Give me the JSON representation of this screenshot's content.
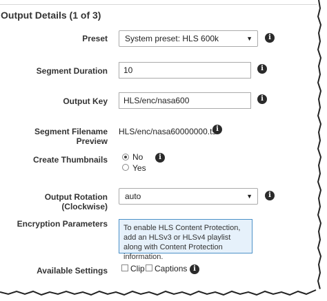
{
  "header": {
    "title": "Output Details (1 of 3)"
  },
  "fields": {
    "preset": {
      "label": "Preset",
      "value": "System preset: HLS 600k"
    },
    "segment_duration": {
      "label": "Segment Duration",
      "value": "10"
    },
    "output_key": {
      "label": "Output Key",
      "value": "HLS/enc/nasa600"
    },
    "segment_filename_preview": {
      "label": "Segment Filename Preview",
      "value": "HLS/enc/nasa60000000.ts"
    },
    "create_thumbnails": {
      "label": "Create Thumbnails",
      "options": [
        "No",
        "Yes"
      ],
      "selected": "No"
    },
    "output_rotation": {
      "label": "Output Rotation",
      "label_sub": "(Clockwise)",
      "value": "auto"
    },
    "encryption": {
      "label": "Encryption Parameters",
      "notice": "To enable HLS Content Protection, add an HLSv3 or HLSv4 playlist along with Content Protection information."
    },
    "available_settings": {
      "label": "Available Settings",
      "options": [
        "Clip",
        "Captions"
      ]
    }
  },
  "icons": {
    "info": "info-icon",
    "dropdown": "chevron-down-icon"
  },
  "colors": {
    "notice_bg": "#e6f1fb",
    "notice_border": "#4a90c8",
    "info_icon": "#2b2b2b"
  }
}
